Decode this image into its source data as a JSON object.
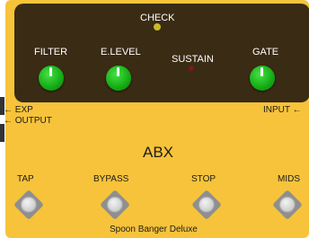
{
  "panel": {
    "check_label": "CHECK",
    "knobs": [
      {
        "label": "FILTER"
      },
      {
        "label": "E.LEVEL"
      },
      {
        "label": "GATE"
      }
    ],
    "sustain_label": "SUSTAIN"
  },
  "jacks": {
    "exp": "← EXP",
    "output": "← OUTPUT",
    "input": "INPUT ←"
  },
  "pedal_name": "ABX",
  "switches": [
    {
      "label": "TAP"
    },
    {
      "label": "BYPASS"
    },
    {
      "label": "STOP"
    },
    {
      "label": "MIDS"
    }
  ],
  "brand": "Spoon Banger Deluxe",
  "colors": {
    "body": "#f7c33a",
    "panel": "#3a2b14",
    "knob": "#17b017",
    "check_led": "#c9b92a",
    "sustain_led": "#7a1a1a"
  }
}
